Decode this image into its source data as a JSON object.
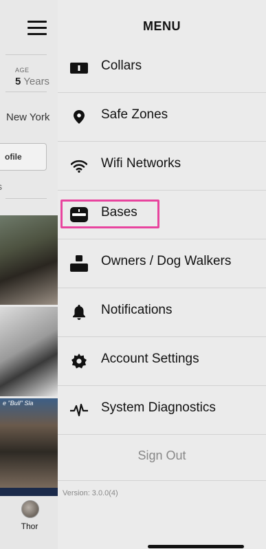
{
  "background": {
    "age_label": "AGE",
    "age_number": "5",
    "age_unit": "Years",
    "city": "New York",
    "profile_button": "ofile",
    "tab_stub": "s",
    "photo_caption": "e \"Bull\" Sla",
    "bottom_tab_name": "Thor"
  },
  "menu": {
    "title": "MENU",
    "items": [
      {
        "label": "Collars",
        "icon": "collar-icon"
      },
      {
        "label": "Safe Zones",
        "icon": "location-pin-icon"
      },
      {
        "label": "Wifi Networks",
        "icon": "wifi-icon"
      },
      {
        "label": "Bases",
        "icon": "base-station-icon"
      },
      {
        "label": "Owners / Dog Walkers",
        "icon": "person-icon"
      },
      {
        "label": "Notifications",
        "icon": "bell-icon"
      },
      {
        "label": "Account Settings",
        "icon": "gear-icon"
      },
      {
        "label": "System Diagnostics",
        "icon": "pulse-icon"
      }
    ],
    "sign_out": "Sign Out",
    "version": "Version: 3.0.0(4)",
    "highlighted_item": "Bases",
    "highlight_color": "#e8449e"
  }
}
